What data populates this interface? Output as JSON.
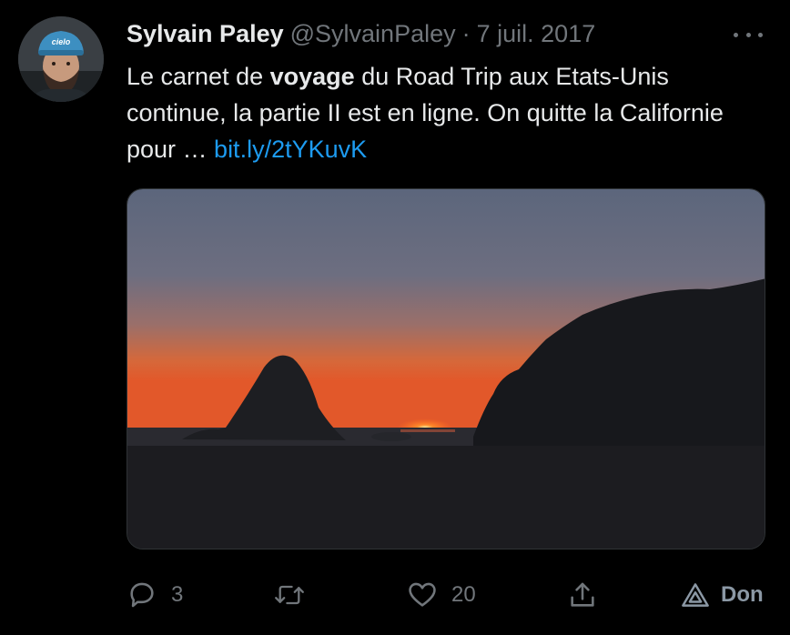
{
  "tweet": {
    "author": {
      "name": "Sylvain Paley",
      "handle": "@SylvainPaley",
      "cap_text": "cielo"
    },
    "separator": "·",
    "date": "7 juil. 2017",
    "text": {
      "part1": "Le carnet de ",
      "bold": "voyage",
      "part2": " du Road Trip aux Etats-Unis continue, la partie II est en ligne. On quitte la Californie pour … ",
      "link": "bit.ly/2tYKuvK"
    },
    "media": {
      "description_icon": "sunset-photo"
    },
    "actions": {
      "reply": {
        "icon": "reply-icon",
        "count": "3"
      },
      "retweet": {
        "icon": "retweet-icon",
        "count": ""
      },
      "like": {
        "icon": "heart-icon",
        "count": "20"
      },
      "share": {
        "icon": "share-icon"
      },
      "donate": {
        "icon": "donate-icon",
        "label": "Don"
      }
    }
  },
  "colors": {
    "background": "#000000",
    "text": "#e7e9ea",
    "secondary": "#71767b",
    "link": "#1d9bf0"
  }
}
